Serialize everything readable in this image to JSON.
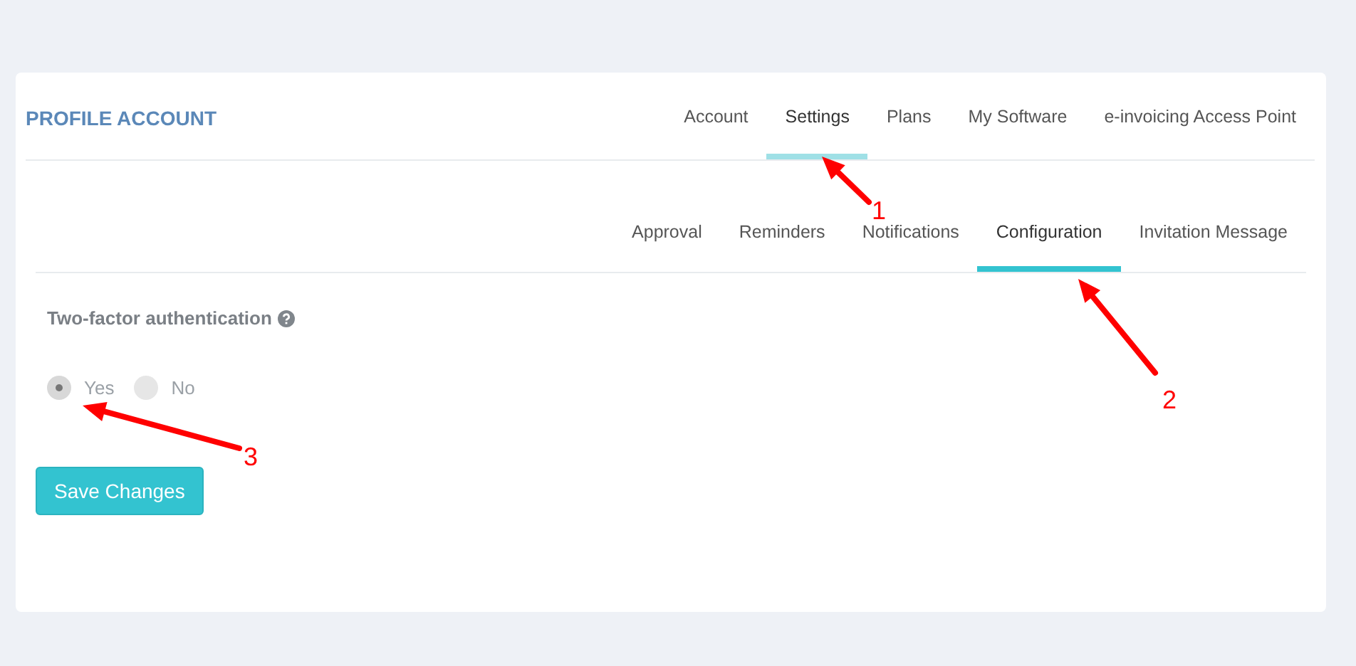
{
  "title": "PROFILE ACCOUNT",
  "tabs": [
    {
      "label": "Account",
      "selected": false
    },
    {
      "label": "Settings",
      "selected": true
    },
    {
      "label": "Plans",
      "selected": false
    },
    {
      "label": "My Software",
      "selected": false
    },
    {
      "label": "e-invoicing Access Point",
      "selected": false
    }
  ],
  "subtabs": [
    {
      "label": "Approval",
      "selected": false
    },
    {
      "label": "Reminders",
      "selected": false
    },
    {
      "label": "Notifications",
      "selected": false
    },
    {
      "label": "Configuration",
      "selected": true
    },
    {
      "label": "Invitation Message",
      "selected": false
    }
  ],
  "two_factor": {
    "label": "Two-factor authentication",
    "options": [
      {
        "label": "Yes",
        "selected": true
      },
      {
        "label": "No",
        "selected": false
      }
    ]
  },
  "save_button": "Save Changes",
  "annotations": [
    {
      "label": "1"
    },
    {
      "label": "2"
    },
    {
      "label": "3"
    }
  ]
}
